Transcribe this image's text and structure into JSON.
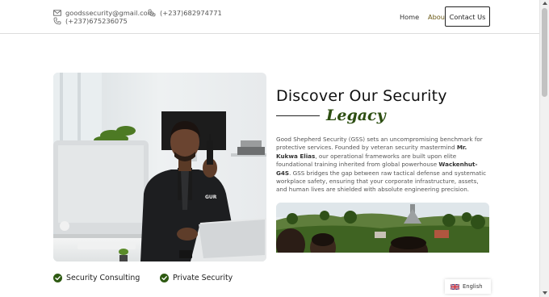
{
  "header": {
    "email": "goodssecurity@gmail.com",
    "phone_primary": "(+237)682974771",
    "phone_secondary": "(+237)675236075",
    "nav": {
      "home": "Home",
      "about": "About",
      "contact": "Contact Us"
    }
  },
  "about": {
    "title": "Discover Our Security",
    "subtitle": "Legacy",
    "intro_part1": "Good Shepherd Security (GSS) sets an uncompromising benchmark for protective services. Founded by veteran security mastermind ",
    "founder": "Mr. Kukwa Elias",
    "intro_part2": ", our operational frameworks are built upon elite foundational training inherited from global powerhouse ",
    "partner": "Wackenhut-G4S",
    "intro_part3": ". GSS bridges the gap between raw tactical defense and systematic workplace safety, ensuring that your corporate infrastructure, assets, and human lives are shielded with absolute engineering precision.",
    "jacket_text": "GUR"
  },
  "services": [
    {
      "label": "Security Consulting"
    },
    {
      "label": "Private Security"
    }
  ],
  "language": {
    "current": "English"
  },
  "colors": {
    "accent_green": "#2d4e12",
    "check_green": "#2e5a12",
    "nav_about": "#6b5a18"
  },
  "icons": [
    "mail-icon",
    "phone-icon",
    "check-circle-icon",
    "uk-flag-icon"
  ]
}
